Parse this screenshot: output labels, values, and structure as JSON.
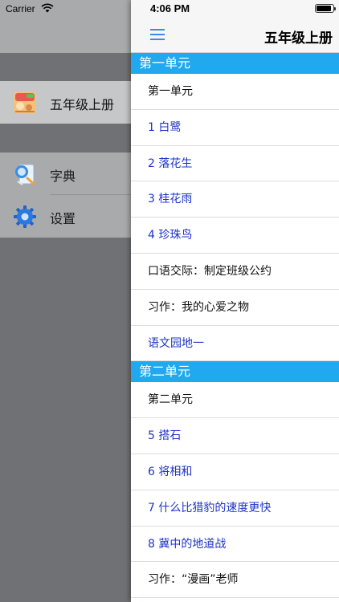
{
  "status_bar": {
    "carrier": "Carrier",
    "time": "4:06 PM",
    "battery_level": 0.9
  },
  "drawer": {
    "items": [
      {
        "label": "五年级上册",
        "icon": "textbook-cover-icon",
        "selected": true
      },
      {
        "label": "字典",
        "icon": "dictionary-icon"
      },
      {
        "label": "设置",
        "icon": "gear-icon"
      }
    ]
  },
  "main": {
    "title": "五年级上册",
    "sections": [
      {
        "header": "第一单元",
        "items": [
          {
            "label": "第一单元",
            "style": "plain"
          },
          {
            "label": "1 白鹭",
            "style": "lesson"
          },
          {
            "label": "2 落花生",
            "style": "lesson"
          },
          {
            "label": "3 桂花雨",
            "style": "lesson"
          },
          {
            "label": "4 珍珠鸟",
            "style": "lesson"
          },
          {
            "label": "口语交际：制定班级公约",
            "style": "plain"
          },
          {
            "label": "习作：我的心爱之物",
            "style": "plain"
          },
          {
            "label": "语文园地一",
            "style": "lesson"
          }
        ]
      },
      {
        "header": "第二单元",
        "items": [
          {
            "label": "第二单元",
            "style": "plain"
          },
          {
            "label": "5 搭石",
            "style": "lesson"
          },
          {
            "label": "6 将相和",
            "style": "lesson"
          },
          {
            "label": "7 什么比猎豹的速度更快",
            "style": "lesson"
          },
          {
            "label": "8 冀中的地道战",
            "style": "lesson"
          },
          {
            "label": "习作：“漫画”老师",
            "style": "plain"
          }
        ]
      }
    ]
  },
  "colors": {
    "section_header": "#20a9ee",
    "lesson_text": "#1e34c8",
    "menu_icon": "#3d8ae4"
  }
}
